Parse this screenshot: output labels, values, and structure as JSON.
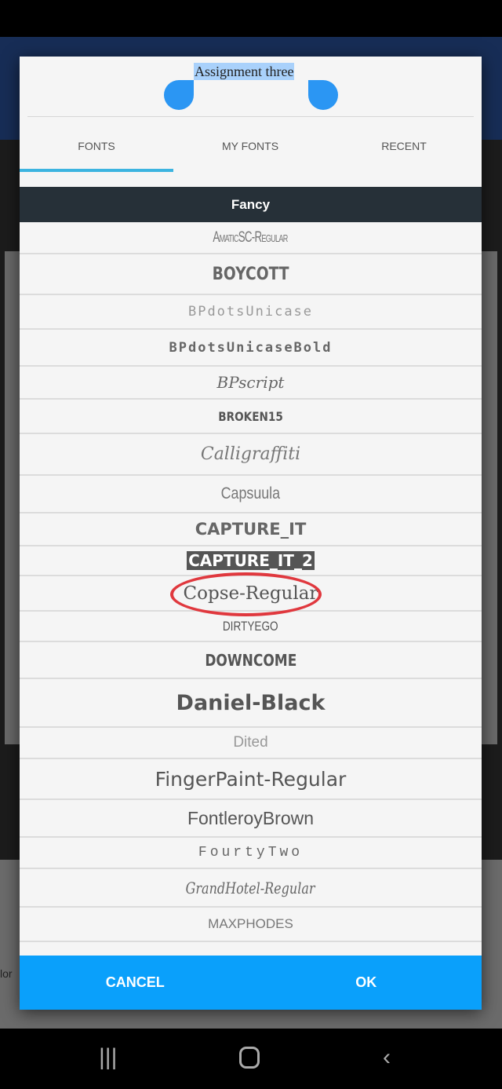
{
  "document_title": "Assignment three",
  "tabs": [
    {
      "label": "FONTS",
      "active": true
    },
    {
      "label": "MY FONTS"
    },
    {
      "label": "RECENT"
    }
  ],
  "category": "Fancy",
  "fonts": [
    "AmaticSC-Regular",
    "BOYCOTT",
    "BPdotsUnicase",
    "BPdotsUnicaseBold",
    "BPscript",
    "BROKEN15",
    "Calligraffiti",
    "Capsuula",
    "CAPTURE_IT",
    "CAPTURE_IT_2",
    "Copse-Regular",
    "DIRTYEGO",
    "DOWNCOME",
    "Daniel-Black",
    "Dited",
    "FingerPaint-Regular",
    "FontleroyBrown",
    "FourtyTwo",
    "GrandHotel-Regular",
    "MAXPHODES",
    "..."
  ],
  "highlighted_font": "Copse-Regular",
  "annotation_color": "#e0383e",
  "buttons": {
    "cancel": "CANCEL",
    "ok": "OK"
  },
  "background_tool_label": "lor",
  "accent_color": "#0aa0fb"
}
